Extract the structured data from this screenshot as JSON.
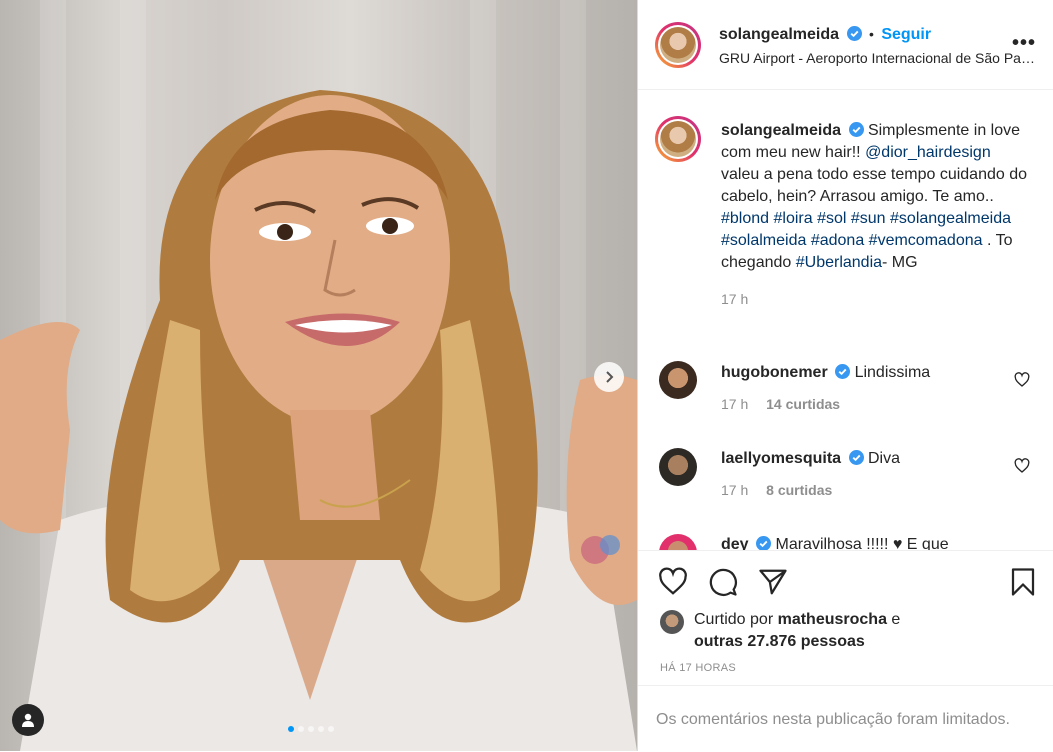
{
  "post": {
    "username": "solangealmeida",
    "follow_label": "Seguir",
    "location": "GRU Airport - Aeroporto Internacional de São Paulo",
    "dot": "•",
    "more": "•••"
  },
  "caption": {
    "username": "solangealmeida",
    "text_1": "Simplesmente in love com meu new hair!!",
    "mention": "@dior_hairdesign",
    "text_2": "valeu a pena todo esse tempo cuidando do cabelo, hein? Arrasou amigo. Te amo..",
    "tags_1": [
      " #blond",
      " #loira",
      "#sol",
      " #sun",
      " #solangealmeida",
      "#solalmeida",
      " #adona",
      " #vemcomadona"
    ],
    "text_3": " . To chegando ",
    "tag_city": "#Uberlandia",
    "text_4": "- MG",
    "time": "17 h"
  },
  "comments": [
    {
      "username": "hugobonemer",
      "text": "Lindissima",
      "time": "17 h",
      "likes": "14 curtidas"
    },
    {
      "username": "laellyomesquita",
      "text": "Diva",
      "time": "17 h",
      "likes": "8 curtidas"
    },
    {
      "username": "dey",
      "text": "Maravilhosa !!!!! ♥ E que",
      "time": "",
      "likes": ""
    }
  ],
  "likes": {
    "prefix": "Curtido por ",
    "user": "matheusrocha",
    "mid": " e",
    "others": "outras 27.876 pessoas"
  },
  "posted": "HÁ 17 HORAS",
  "limited": "Os comentários nesta publicação foram limitados.",
  "colors": {
    "accent": "#0095f6",
    "verified": "#3897f0",
    "link": "#00376b"
  }
}
